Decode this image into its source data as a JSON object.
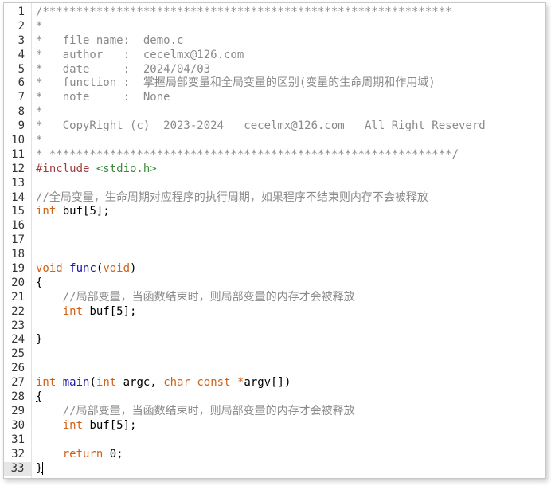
{
  "editor": {
    "current_line": "33",
    "lines": [
      {
        "n": "1",
        "tokens": [
          {
            "t": "cm",
            "v": "/*************************************************************"
          }
        ]
      },
      {
        "n": "2",
        "tokens": [
          {
            "t": "cm",
            "v": "*"
          }
        ]
      },
      {
        "n": "3",
        "tokens": [
          {
            "t": "cm",
            "v": "*   file name:  demo.c"
          }
        ]
      },
      {
        "n": "4",
        "tokens": [
          {
            "t": "cm",
            "v": "*   author   :  cecelmx@126.com"
          }
        ]
      },
      {
        "n": "5",
        "tokens": [
          {
            "t": "cm",
            "v": "*   date     :  2024/04/03"
          }
        ]
      },
      {
        "n": "6",
        "tokens": [
          {
            "t": "cm",
            "v": "*   function :  掌握局部变量和全局变量的区别(变量的生命周期和作用域)"
          }
        ]
      },
      {
        "n": "7",
        "tokens": [
          {
            "t": "cm",
            "v": "*   note     :  None"
          }
        ]
      },
      {
        "n": "8",
        "tokens": [
          {
            "t": "cm",
            "v": "*"
          }
        ]
      },
      {
        "n": "9",
        "tokens": [
          {
            "t": "cm",
            "v": "*   CopyRight (c)  2023-2024   cecelmx@126.com   All Right Reseverd"
          }
        ]
      },
      {
        "n": "10",
        "tokens": [
          {
            "t": "cm",
            "v": "*"
          }
        ]
      },
      {
        "n": "11",
        "tokens": [
          {
            "t": "cm",
            "v": "* ************************************************************/"
          }
        ]
      },
      {
        "n": "12",
        "tokens": [
          {
            "t": "pp",
            "v": "#include "
          },
          {
            "t": "str",
            "v": "<stdio.h>"
          }
        ]
      },
      {
        "n": "13",
        "tokens": []
      },
      {
        "n": "14",
        "tokens": [
          {
            "t": "cm",
            "v": "//全局变量，生命周期对应程序的执行周期，如果程序不结束则内存不会被释放"
          }
        ]
      },
      {
        "n": "15",
        "tokens": [
          {
            "t": "kw",
            "v": "int"
          },
          {
            "t": "pl",
            "v": " buf["
          },
          {
            "t": "num",
            "v": "5"
          },
          {
            "t": "pl",
            "v": "];"
          }
        ]
      },
      {
        "n": "16",
        "tokens": []
      },
      {
        "n": "17",
        "tokens": []
      },
      {
        "n": "18",
        "tokens": []
      },
      {
        "n": "19",
        "tokens": [
          {
            "t": "kw",
            "v": "void"
          },
          {
            "t": "pl",
            "v": " "
          },
          {
            "t": "fn",
            "v": "func"
          },
          {
            "t": "pl",
            "v": "("
          },
          {
            "t": "kw",
            "v": "void"
          },
          {
            "t": "pl",
            "v": ")"
          }
        ]
      },
      {
        "n": "20",
        "tokens": [
          {
            "t": "pl",
            "v": "{"
          }
        ]
      },
      {
        "n": "21",
        "tokens": [
          {
            "t": "pl",
            "v": "    "
          },
          {
            "t": "cm",
            "v": "//局部变量，当函数结束时，则局部变量的内存才会被释放"
          }
        ]
      },
      {
        "n": "22",
        "tokens": [
          {
            "t": "pl",
            "v": "    "
          },
          {
            "t": "kw",
            "v": "int"
          },
          {
            "t": "pl",
            "v": " buf["
          },
          {
            "t": "num",
            "v": "5"
          },
          {
            "t": "pl",
            "v": "];"
          }
        ]
      },
      {
        "n": "23",
        "tokens": []
      },
      {
        "n": "24",
        "tokens": [
          {
            "t": "pl",
            "v": "}"
          }
        ]
      },
      {
        "n": "25",
        "tokens": []
      },
      {
        "n": "26",
        "tokens": []
      },
      {
        "n": "27",
        "tokens": [
          {
            "t": "kw",
            "v": "int"
          },
          {
            "t": "pl",
            "v": " "
          },
          {
            "t": "fn",
            "v": "main"
          },
          {
            "t": "pl",
            "v": "("
          },
          {
            "t": "kw",
            "v": "int"
          },
          {
            "t": "pl",
            "v": " argc, "
          },
          {
            "t": "kw",
            "v": "char"
          },
          {
            "t": "pl",
            "v": " "
          },
          {
            "t": "kw",
            "v": "const"
          },
          {
            "t": "pl",
            "v": " "
          },
          {
            "t": "kw",
            "v": "*"
          },
          {
            "t": "pl",
            "v": "argv[])"
          }
        ]
      },
      {
        "n": "28",
        "tokens": [
          {
            "t": "ul",
            "v": "{"
          }
        ]
      },
      {
        "n": "29",
        "tokens": [
          {
            "t": "pl",
            "v": "    "
          },
          {
            "t": "cm",
            "v": "//局部变量，当函数结束时，则局部变量的内存才会被释放"
          }
        ]
      },
      {
        "n": "30",
        "tokens": [
          {
            "t": "pl",
            "v": "    "
          },
          {
            "t": "kw",
            "v": "int"
          },
          {
            "t": "pl",
            "v": " buf["
          },
          {
            "t": "num",
            "v": "5"
          },
          {
            "t": "pl",
            "v": "];"
          }
        ]
      },
      {
        "n": "31",
        "tokens": []
      },
      {
        "n": "32",
        "tokens": [
          {
            "t": "pl",
            "v": "    "
          },
          {
            "t": "kw",
            "v": "return"
          },
          {
            "t": "pl",
            "v": " "
          },
          {
            "t": "num",
            "v": "0"
          },
          {
            "t": "pl",
            "v": ";"
          }
        ]
      },
      {
        "n": "33",
        "tokens": [
          {
            "t": "ul",
            "v": "}"
          },
          {
            "t": "caret",
            "v": ""
          }
        ]
      }
    ]
  },
  "colors": {
    "comment": "#8a8a8a",
    "keyword": "#d0611a",
    "function": "#1a1aa6",
    "preprocessor": "#a03c3c",
    "string": "#3c8a3c"
  }
}
